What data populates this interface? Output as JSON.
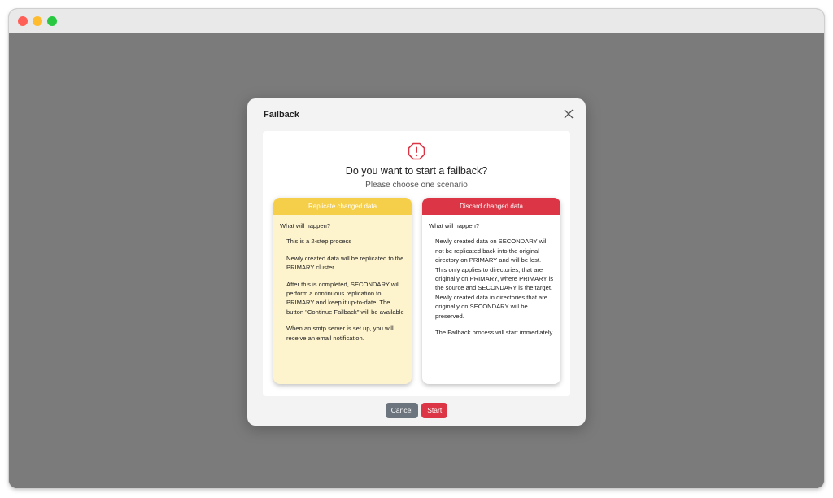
{
  "dialog": {
    "title": "Failback",
    "question": "Do you want to start a failback?",
    "subquestion": "Please choose one scenario"
  },
  "cards": [
    {
      "header": "Replicate changed data",
      "lead": "What will happen?",
      "items": [
        "This is a 2-step process",
        "Newly created data will be replicated to the PRIMARY cluster",
        "After this is completed, SECONDARY will perform a continuous replication to PRIMARY and keep it up-to-date. The button \"Continue Failback\" will be available",
        "When an smtp server is set up, you will receive an email notification."
      ]
    },
    {
      "header": "Discard changed data",
      "lead": "What will happen?",
      "items": [
        "Newly created data on SECONDARY will not be replicated back into the original directory on PRIMARY and will be lost. This only applies to directories, that are originally on PRIMARY, where PRIMARY is the source and SECONDARY is the target. Newly created data in directories that are originally on SECONDARY will be preserved.",
        "The Failback process will start immediately."
      ]
    }
  ],
  "buttons": {
    "cancel": "Cancel",
    "start": "Start"
  },
  "colors": {
    "accent_yellow": "#f5cf49",
    "accent_red": "#dc3545",
    "cancel_gray": "#6c757d",
    "backdrop": "#7b7b7b"
  },
  "icons": {
    "close": "close-icon",
    "warning": "exclamation-octagon-icon"
  }
}
